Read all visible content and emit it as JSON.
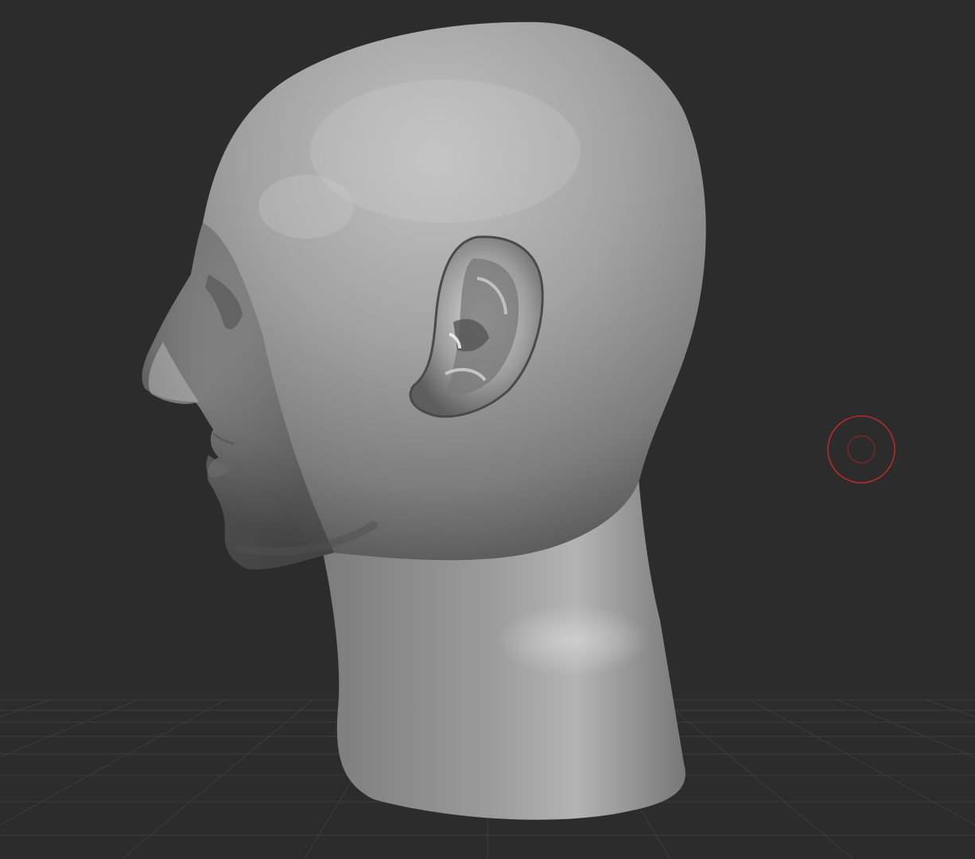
{
  "viewport": {
    "background_color": "#2c2c2c",
    "grid_color": "#3d3d3d",
    "model": {
      "name": "sculpted-head",
      "base_color": "#8d8d8d",
      "highlight_color": "#c4c4c4",
      "shadow_color": "#4a4a4a"
    },
    "brush_cursor": {
      "icon": "brush-circle-icon",
      "color": "#b52a2a"
    }
  }
}
